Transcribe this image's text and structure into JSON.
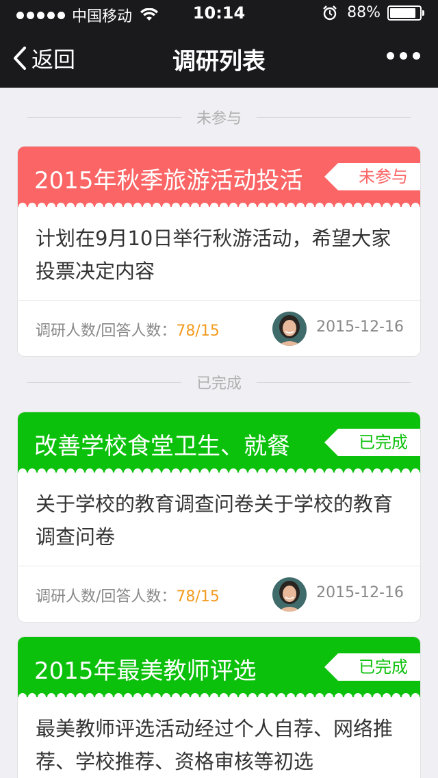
{
  "status_bar": {
    "carrier": "中国移动",
    "time": "10:14",
    "battery": "88%",
    "battery_level": 0.88
  },
  "nav": {
    "back_label": "返回",
    "title": "调研列表",
    "more_icon": "more-dots-icon"
  },
  "sections": {
    "not_participated": "未参与",
    "completed": "已完成"
  },
  "cards": [
    {
      "title": "2015年秋季旅游活动投活",
      "tag": "未参与",
      "theme": "#fb6565",
      "description": "计划在9月10日举行秋游活动，希望大家投票决定内容",
      "count_label": "调研人数/回答人数：",
      "count": "78/15",
      "date": "2015-12-16"
    },
    {
      "title": "改善学校食堂卫生、就餐",
      "tag": "已完成",
      "theme": "#0cc10c",
      "description": "关于学校的教育调查问卷关于学校的教育调查问卷",
      "count_label": "调研人数/回答人数：",
      "count": "78/15",
      "date": "2015-12-16"
    },
    {
      "title": "2015年最美教师评选",
      "tag": "已完成",
      "theme": "#0cc10c",
      "description": "最美教师评选活动经过个人自荐、网络推荐、学校推荐、资格审核等初选"
    }
  ],
  "colors": {
    "nav_bg": "#1a1a1c",
    "page_bg": "#efeff4",
    "count_accent": "#f29b1f"
  }
}
